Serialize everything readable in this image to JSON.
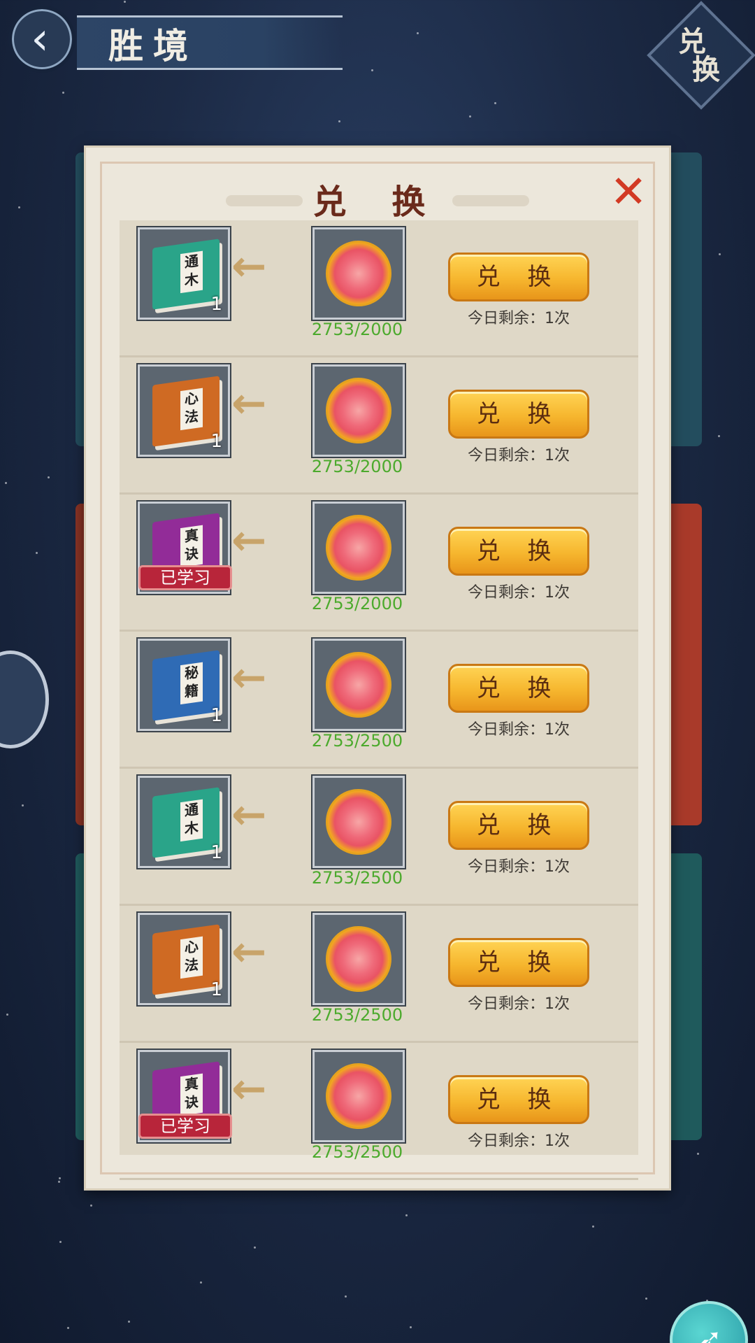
{
  "header": {
    "title": "胜境",
    "back_icon": "chevron-left-icon",
    "corner_label_top": "兑",
    "corner_label_bottom": "换"
  },
  "dialog": {
    "title": "兑 换",
    "close_label": "✕"
  },
  "rows": [
    {
      "book_color": "#2aa489",
      "book_text": "通木",
      "count": "1",
      "learned": "",
      "cost": "2753/2000",
      "button": "兑 换",
      "remaining": "今日剩余：1次"
    },
    {
      "book_color": "#cf6a23",
      "book_text": "心法",
      "count": "1",
      "learned": "",
      "cost": "2753/2000",
      "button": "兑 换",
      "remaining": "今日剩余：1次"
    },
    {
      "book_color": "#922c98",
      "book_text": "真诀",
      "count": "",
      "learned": "已学习",
      "cost": "2753/2000",
      "button": "兑 换",
      "remaining": "今日剩余：1次"
    },
    {
      "book_color": "#2f6bb5",
      "book_text": "秘籍",
      "count": "1",
      "learned": "",
      "cost": "2753/2500",
      "button": "兑 换",
      "remaining": "今日剩余：1次"
    },
    {
      "book_color": "#2aa489",
      "book_text": "通木",
      "count": "1",
      "learned": "",
      "cost": "2753/2500",
      "button": "兑 换",
      "remaining": "今日剩余：1次"
    },
    {
      "book_color": "#cf6a23",
      "book_text": "心法",
      "count": "1",
      "learned": "",
      "cost": "2753/2500",
      "button": "兑 换",
      "remaining": "今日剩余：1次"
    },
    {
      "book_color": "#922c98",
      "book_text": "真诀",
      "count": "",
      "learned": "已学习",
      "cost": "2753/2500",
      "button": "兑 换",
      "remaining": "今日剩余：1次"
    }
  ],
  "colors": {
    "cost_green": "#4caa2d",
    "button_gold": "#f6b62e",
    "learned_red": "#b8253a",
    "close_red": "#d23a24"
  }
}
